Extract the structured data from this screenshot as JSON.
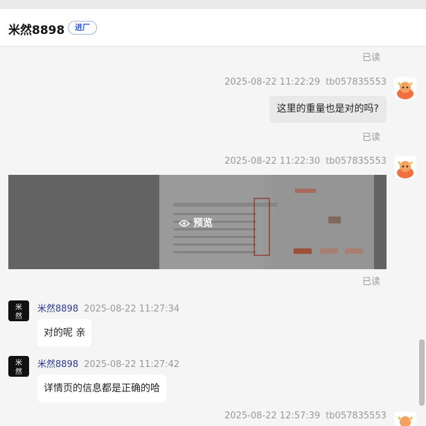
{
  "header": {
    "shop_name": "米然8898",
    "badge": "进厂"
  },
  "messages": {
    "read_top": "已读",
    "m1": {
      "time": "2025-08-22 11:22:29",
      "sender": "tb057835553",
      "text": "这里的重量也是对的吗?",
      "read": "已读"
    },
    "m2": {
      "time": "2025-08-22 11:22:30",
      "sender": "tb057835553",
      "preview_label": "预览",
      "read": "已读"
    },
    "m3": {
      "name": "米然8898",
      "time": "2025-08-22 11:27:34",
      "text": "对的呢 亲"
    },
    "m4": {
      "name": "米然8898",
      "time": "2025-08-22 11:27:42",
      "text": "详情页的信息都是正确的哈"
    },
    "m5": {
      "time": "2025-08-22 12:57:39",
      "sender": "tb057835553"
    }
  },
  "colors": {
    "badge_border": "#9db7e8",
    "name_blue": "#2b3a8f",
    "avatar_orange": "#f07040"
  }
}
